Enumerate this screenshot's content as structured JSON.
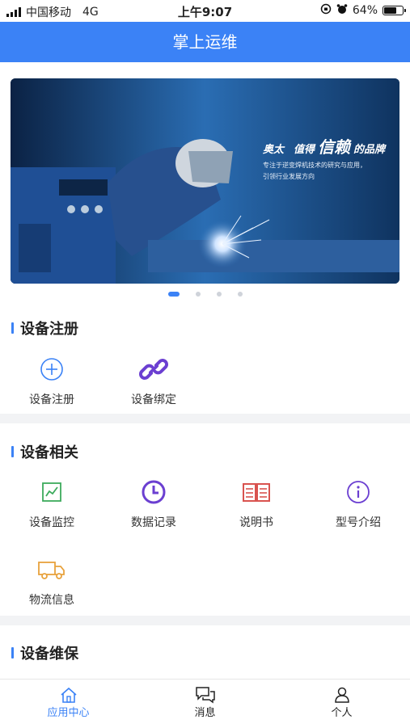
{
  "status": {
    "carrier": "中国移动",
    "network": "4G",
    "time": "上午9:07",
    "battery": "64%"
  },
  "header": {
    "title": "掌上运维"
  },
  "banner": {
    "headline_1": "奥太",
    "headline_2": "值得",
    "headline_3": "信赖",
    "headline_4": "的品牌",
    "line_1": "专注于逆变焊机技术的研究与应用，",
    "line_2": "引领行业发展方向",
    "slide_count": 4,
    "active_slide": 1
  },
  "sections": [
    {
      "title": "设备注册",
      "items": [
        {
          "label": "设备注册",
          "icon": "plus-circle-icon"
        },
        {
          "label": "设备绑定",
          "icon": "link-icon"
        }
      ]
    },
    {
      "title": "设备相关",
      "items": [
        {
          "label": "设备监控",
          "icon": "chart-icon"
        },
        {
          "label": "数据记录",
          "icon": "clock-icon"
        },
        {
          "label": "说明书",
          "icon": "book-icon"
        },
        {
          "label": "型号介绍",
          "icon": "info-icon"
        },
        {
          "label": "物流信息",
          "icon": "truck-icon"
        }
      ]
    },
    {
      "title": "设备维保",
      "items": []
    }
  ],
  "tabs": [
    {
      "label": "应用中心",
      "icon": "home-icon",
      "active": true
    },
    {
      "label": "消息",
      "icon": "chat-icon",
      "active": false
    },
    {
      "label": "个人",
      "icon": "user-icon",
      "active": false
    }
  ],
  "colors": {
    "accent": "#3b82f6",
    "purple": "#6b3fd1",
    "green": "#3cab5c",
    "red": "#d9534f",
    "orange": "#e8a23d"
  }
}
